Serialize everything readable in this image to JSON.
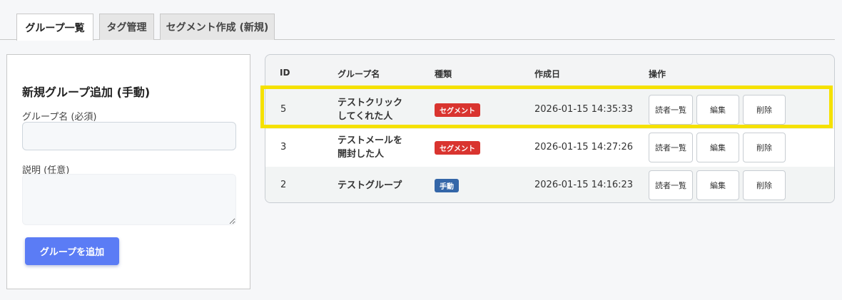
{
  "tabs": [
    {
      "label": "グループ一覧",
      "active": true
    },
    {
      "label": "タグ管理",
      "active": false
    },
    {
      "label": "セグメント作成 (新規)",
      "active": false
    }
  ],
  "form": {
    "title": "新規グループ追加 (手動)",
    "name_label": "グループ名 (必須)",
    "name_value": "",
    "description_label": "説明 (任意)",
    "description_value": "",
    "submit_label": "グループを追加"
  },
  "table": {
    "headers": {
      "id": "ID",
      "name": "グループ名",
      "type": "種類",
      "created": "作成日",
      "actions": "操作"
    },
    "rows": [
      {
        "id": "5",
        "name_lines": [
          "テストクリック",
          "してくれた人"
        ],
        "type": "セグメント",
        "type_kind": "segment",
        "created": "2026-01-15 14:35:33"
      },
      {
        "id": "3",
        "name_lines": [
          "テストメールを",
          "開封した人"
        ],
        "type": "セグメント",
        "type_kind": "segment",
        "created": "2026-01-15 14:27:26"
      },
      {
        "id": "2",
        "name_lines": [
          "テストグループ"
        ],
        "type": "手動",
        "type_kind": "manual",
        "created": "2026-01-15 14:16:23"
      }
    ],
    "actions": {
      "readers": "読者一覧",
      "edit": "編集",
      "delete": "削除"
    }
  },
  "colors": {
    "accent": "#5b7cf5",
    "segment_badge": "#d9342f",
    "manual_badge": "#3466a8",
    "highlight": "#f5e100"
  }
}
